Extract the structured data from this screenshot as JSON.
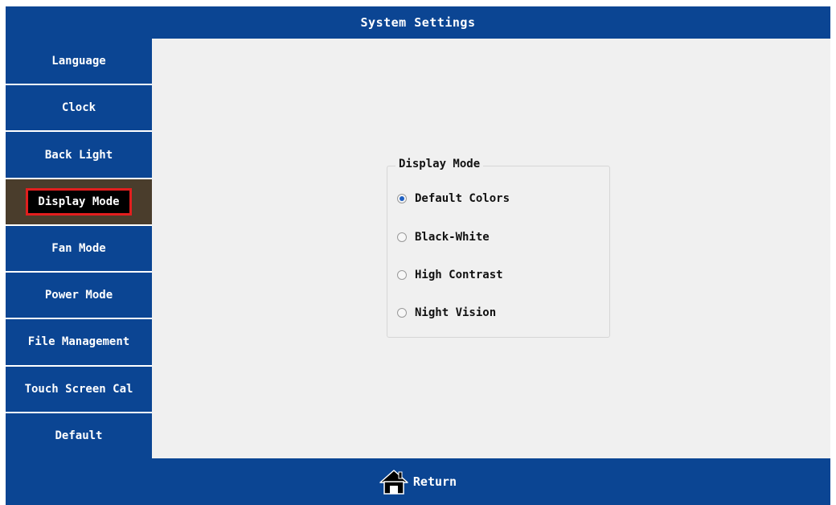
{
  "header": {
    "title": "System Settings"
  },
  "sidebar": {
    "items": [
      {
        "label": "Language"
      },
      {
        "label": "Clock"
      },
      {
        "label": "Back Light"
      },
      {
        "label": "Display Mode"
      },
      {
        "label": "Fan Mode"
      },
      {
        "label": "Power Mode"
      },
      {
        "label": "File Management"
      },
      {
        "label": "Touch Screen Cal"
      },
      {
        "label": "Default"
      }
    ],
    "active_index": 3
  },
  "display_mode": {
    "title": "Display Mode",
    "options": [
      {
        "label": "Default Colors",
        "checked": true
      },
      {
        "label": "Black-White",
        "checked": false
      },
      {
        "label": "High Contrast",
        "checked": false
      },
      {
        "label": "Night Vision",
        "checked": false
      }
    ]
  },
  "footer": {
    "return_label": "Return",
    "icon": "home-icon"
  },
  "colors": {
    "primary": "#0b4593",
    "active_item_bg": "#4a3d2c",
    "active_highlight_border": "#e21e1e",
    "content_bg": "#f0f0f0"
  }
}
